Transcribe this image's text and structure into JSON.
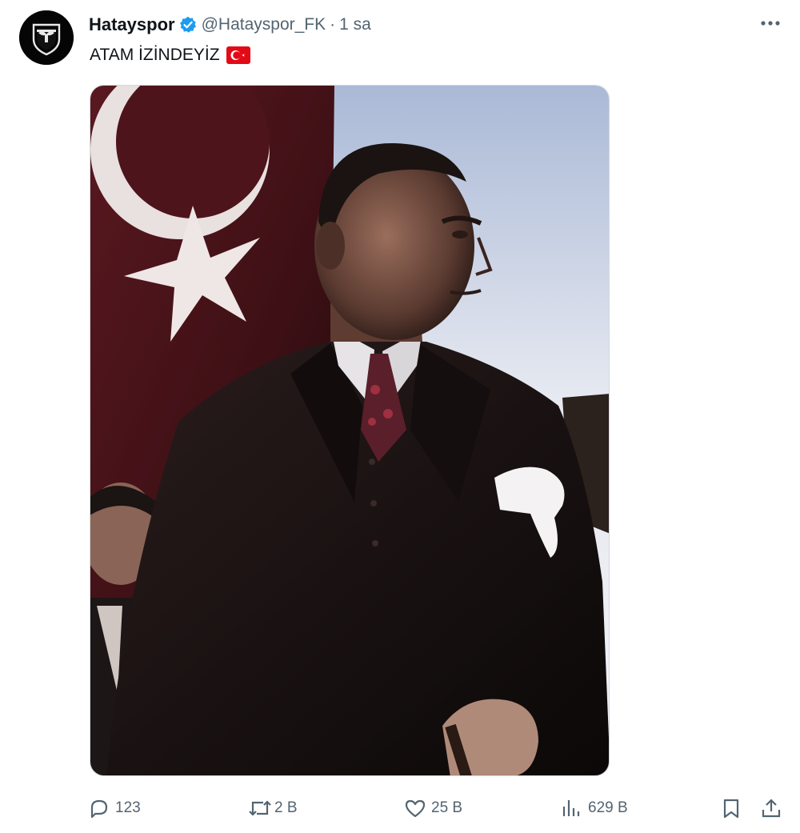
{
  "tweet": {
    "display_name": "Hatayspor",
    "handle": "@Hatayspor_FK",
    "separator": "·",
    "time": "1 sa",
    "text": "ATAM İZİNDEYİZ",
    "verified": true
  },
  "metrics": {
    "replies": "123",
    "reposts": "2 B",
    "likes": "25 B",
    "views": "629 B"
  },
  "icons": {
    "avatar": "hatayspor-logo",
    "verified": "verified-badge-icon",
    "more": "more-icon",
    "reply": "reply-icon",
    "repost": "repost-icon",
    "like": "heart-icon",
    "views": "views-icon",
    "bookmark": "bookmark-icon",
    "share": "share-icon",
    "emoji": "turkey-flag-emoji"
  },
  "colors": {
    "text_primary": "#0f1419",
    "text_secondary": "#536471",
    "verified_blue": "#1d9bf0",
    "flag_red": "#e30a17"
  }
}
